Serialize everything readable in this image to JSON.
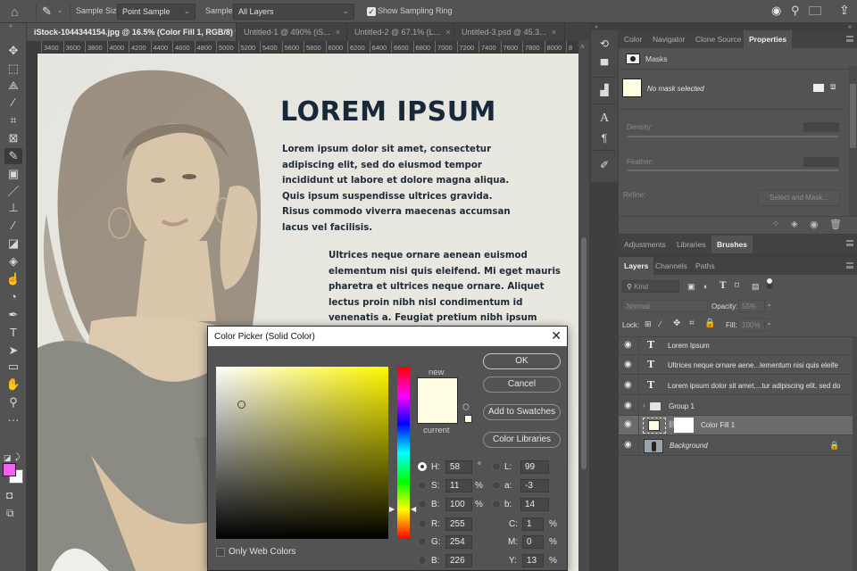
{
  "options_bar": {
    "sample_size_label": "Sample Size:",
    "sample_size_value": "Point Sample",
    "sample_label": "Sample:",
    "sample_value": "All Layers",
    "show_sampling_ring_label": "Show Sampling Ring",
    "show_sampling_ring_checked": true
  },
  "document_tabs": [
    {
      "label": "iStock-1044344154.jpg @ 16.5% (Color Fill 1, RGB/8) *",
      "active": true
    },
    {
      "label": "Untitled-1 @ 490% (iS...",
      "active": false
    },
    {
      "label": "Untitled-2 @ 67.1% (L...",
      "active": false
    },
    {
      "label": "Untitled-3.psd @ 45.3...",
      "active": false
    }
  ],
  "close_glyph": "×",
  "ruler_ticks": [
    "3400",
    "3600",
    "3800",
    "4000",
    "4200",
    "4400",
    "4600",
    "4800",
    "5000",
    "5200",
    "5400",
    "5600",
    "5800",
    "6000",
    "6200",
    "6400",
    "6600",
    "6800",
    "7000",
    "7200",
    "7400",
    "7600",
    "7800",
    "8000",
    "8"
  ],
  "tools": [
    {
      "name": "move-tool",
      "glyph": "✥"
    },
    {
      "name": "marquee-tool",
      "glyph": "⬚"
    },
    {
      "name": "lasso-tool",
      "glyph": "⟁"
    },
    {
      "name": "magic-wand-tool",
      "glyph": "⁄"
    },
    {
      "name": "crop-tool",
      "glyph": "⌗"
    },
    {
      "name": "frame-tool",
      "glyph": "⊠"
    },
    {
      "name": "eyedropper-tool",
      "glyph": "✎"
    },
    {
      "name": "spot-healing-tool",
      "glyph": "▣"
    },
    {
      "name": "brush-tool",
      "glyph": "／"
    },
    {
      "name": "clone-stamp-tool",
      "glyph": "⊥"
    },
    {
      "name": "history-brush-tool",
      "glyph": "⁄"
    },
    {
      "name": "eraser-tool",
      "glyph": "◪"
    },
    {
      "name": "paint-bucket-tool",
      "glyph": "◈"
    },
    {
      "name": "smudge-tool",
      "glyph": "☝"
    },
    {
      "name": "dodge-tool",
      "glyph": "◔"
    },
    {
      "name": "pen-tool",
      "glyph": "✒"
    },
    {
      "name": "type-tool",
      "glyph": "T"
    },
    {
      "name": "path-selection-tool",
      "glyph": "➤"
    },
    {
      "name": "rectangle-tool",
      "glyph": "▭"
    },
    {
      "name": "hand-tool",
      "glyph": "✋"
    },
    {
      "name": "zoom-tool",
      "glyph": "⚲"
    },
    {
      "name": "more-tools",
      "glyph": "···"
    }
  ],
  "foreground_color": "#f062f0",
  "background_color": "#ffffff",
  "canvas": {
    "headline": "LOREM IPSUM",
    "paragraph1": "Lorem ipsum dolor sit amet, consectetur adipiscing elit, sed do eiusmod tempor incididunt ut labore et dolore magna aliqua. Quis ipsum suspendisse ultrices gravida. Risus commodo viverra maecenas accumsan lacus vel facilisis.",
    "paragraph2": "Ultrices neque ornare aenean euismod elementum nisi quis eleifend. Mi eget mauris pharetra et ultrices neque ornare. Aliquet lectus proin nibh nisl condimentum id venenatis a. Feugiat pretium nibh ipsum consequat nisl vel pretium lectus quam."
  },
  "color_picker": {
    "title": "Color Picker (Solid Color)",
    "new_label": "new",
    "current_label": "current",
    "new_color": "#fffee2",
    "current_color": "#fffee2",
    "buttons": {
      "ok": "OK",
      "cancel": "Cancel",
      "add_to_swatches": "Add to Swatches",
      "color_libraries": "Color Libraries"
    },
    "fields": {
      "H": {
        "label": "H:",
        "value": "58",
        "unit": "°"
      },
      "S": {
        "label": "S:",
        "value": "11",
        "unit": "%"
      },
      "B": {
        "label": "B:",
        "value": "100",
        "unit": "%"
      },
      "R": {
        "label": "R:",
        "value": "255"
      },
      "G": {
        "label": "G:",
        "value": "254"
      },
      "Bl": {
        "label": "B:",
        "value": "226"
      },
      "L": {
        "label": "L:",
        "value": "99"
      },
      "a": {
        "label": "a:",
        "value": "-3"
      },
      "b": {
        "label": "b:",
        "value": "14"
      },
      "C": {
        "label": "C:",
        "value": "1",
        "unit": "%"
      },
      "M": {
        "label": "M:",
        "value": "0",
        "unit": "%"
      },
      "Y": {
        "label": "Y:",
        "value": "13",
        "unit": "%"
      }
    },
    "selected_channel": "H",
    "only_web_colors_label": "Only Web Colors",
    "only_web_colors_checked": false
  },
  "properties_panel": {
    "tabs": [
      "Color",
      "Navigator",
      "Clone Source",
      "Properties"
    ],
    "active_tab": "Properties",
    "section_label": "Masks",
    "mask_status": "No mask selected",
    "density_label": "Density:",
    "feather_label": "Feather:",
    "refine_label": "Refine:",
    "select_and_mask_label": "Select and Mask..."
  },
  "adjustments_panel": {
    "tabs": [
      "Adjustments",
      "Libraries",
      "Brushes"
    ],
    "active_tab": "Brushes"
  },
  "layers_panel": {
    "tabs": [
      "Layers",
      "Channels",
      "Paths"
    ],
    "active_tab": "Layers",
    "filter_kind": "Kind",
    "blend_mode": "Normal",
    "opacity_label": "Opacity:",
    "opacity_value": "55%",
    "lock_label": "Lock:",
    "fill_label": "Fill:",
    "fill_value": "100%",
    "layers": [
      {
        "name": "Lorem Ipsum",
        "type": "text",
        "visible": true
      },
      {
        "name": "Ultrices neque ornare aene...lementum nisi quis eleife",
        "type": "text",
        "visible": true
      },
      {
        "name": "Lorem ipsum dolor sit amet,...tur adipiscing elit, sed do",
        "type": "text",
        "visible": true
      },
      {
        "name": "Group 1",
        "type": "group",
        "visible": true
      },
      {
        "name": "Color Fill 1",
        "type": "fill",
        "visible": true,
        "selected": true,
        "fill_color": "#fffee2"
      },
      {
        "name": "Background",
        "type": "image",
        "visible": true,
        "locked": true
      }
    ]
  }
}
